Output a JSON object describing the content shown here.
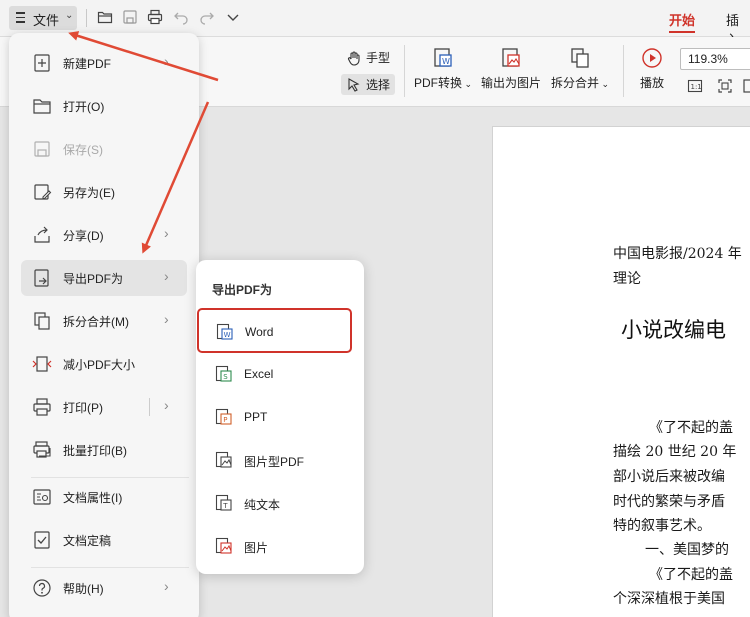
{
  "topbar": {
    "file_label": "文件",
    "tabs": [
      {
        "label": "开始",
        "active": true
      },
      {
        "label": "插入",
        "active": false
      }
    ],
    "quick_icons": [
      "open-folder-icon",
      "save-icon",
      "print-icon",
      "undo-icon",
      "redo-icon",
      "more-dropdown-icon"
    ]
  },
  "ribbon": {
    "hand_label": "手型",
    "select_label": "选择",
    "pdf_convert_label": "PDF转换",
    "export_image_label": "输出为图片",
    "split_merge_label": "拆分合并",
    "play_label": "播放",
    "zoom_value": "119.3%"
  },
  "file_menu": {
    "items": [
      {
        "label": "新建PDF",
        "icon": "new-pdf-icon",
        "arrow": true
      },
      {
        "label": "打开(O)",
        "icon": "open-folder-icon",
        "arrow": false
      },
      {
        "label": "保存(S)",
        "icon": "save-icon",
        "arrow": false,
        "disabled": true
      },
      {
        "label": "另存为(E)",
        "icon": "save-as-icon",
        "arrow": false
      },
      {
        "label": "分享(D)",
        "icon": "share-icon",
        "arrow": true
      },
      {
        "label": "导出PDF为",
        "icon": "export-pdf-icon",
        "arrow": true,
        "hover": true
      },
      {
        "label": "拆分合并(M)",
        "icon": "split-merge-icon",
        "arrow": true
      },
      {
        "label": "减小PDF大小",
        "icon": "compress-icon",
        "arrow": false
      },
      {
        "label": "打印(P)",
        "icon": "print-icon",
        "arrow": true
      },
      {
        "label": "批量打印(B)",
        "icon": "batch-print-icon",
        "arrow": false
      },
      {
        "label": "文档属性(I)",
        "icon": "doc-properties-icon",
        "arrow": false
      },
      {
        "label": "文档定稿",
        "icon": "finalize-icon",
        "arrow": false
      },
      {
        "label": "帮助(H)",
        "icon": "help-icon",
        "arrow": true
      }
    ]
  },
  "submenu": {
    "title": "导出PDF为",
    "items": [
      {
        "label": "Word",
        "icon": "word-icon",
        "highlighted": true
      },
      {
        "label": "Excel",
        "icon": "excel-icon"
      },
      {
        "label": "PPT",
        "icon": "ppt-icon"
      },
      {
        "label": "图片型PDF",
        "icon": "image-pdf-icon"
      },
      {
        "label": "纯文本",
        "icon": "plain-text-icon"
      },
      {
        "label": "图片",
        "icon": "image-icon"
      }
    ]
  },
  "document": {
    "line1": "中国电影报/2024 年",
    "line2": "理论",
    "title": "小说改编电",
    "para": [
      "《了不起的盖",
      "描绘 20 世纪 20 年",
      "部小说后来被改编",
      "时代的繁荣与矛盾",
      "特的叙事艺术。",
      "一、美国梦的",
      "《了不起的盖",
      "个深深植根于美国"
    ]
  },
  "colors": {
    "accent": "#d0332a",
    "menu_bg": "#f6f6f6",
    "hover_bg": "#e4e4e4"
  }
}
